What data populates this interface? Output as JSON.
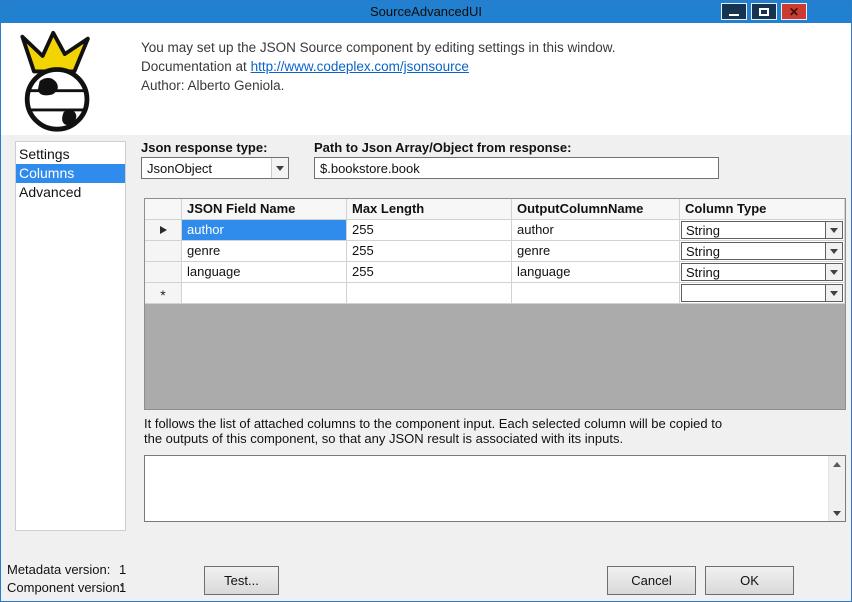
{
  "window": {
    "title": "SourceAdvancedUI"
  },
  "header": {
    "intro": "You may set up the JSON Source component by editing settings in this window.",
    "doc_prefix": "Documentation at",
    "doc_link": "http://www.codeplex.com/jsonsource",
    "author": "Author: Alberto Geniola."
  },
  "sidebar": {
    "items": [
      {
        "label": "Settings",
        "selected": false
      },
      {
        "label": "Columns",
        "selected": true
      },
      {
        "label": "Advanced",
        "selected": false
      }
    ]
  },
  "form": {
    "response_type_label": "Json response type:",
    "response_type_value": "JsonObject",
    "path_label": "Path to Json Array/Object from response:",
    "path_value": "$.bookstore.book"
  },
  "grid": {
    "columns": [
      "JSON Field Name",
      "Max Length",
      "OutputColumnName",
      "Column Type"
    ],
    "rows": [
      {
        "field": "author",
        "max_length": "255",
        "output": "author",
        "type": "String"
      },
      {
        "field": "genre",
        "max_length": "255",
        "output": "genre",
        "type": "String"
      },
      {
        "field": "language",
        "max_length": "255",
        "output": "language",
        "type": "String"
      }
    ],
    "new_row_marker": "*"
  },
  "description": "It follows the list of attached columns to the component input. Each selected column will be copied to the outputs of this component, so that any JSON result is associated with its inputs.",
  "footer": {
    "metadata_version_label": "Metadata version:",
    "metadata_version_value": "1",
    "component_version_label": "Component version:",
    "component_version_value": "1"
  },
  "buttons": {
    "test": "Test...",
    "cancel": "Cancel",
    "ok": "OK"
  },
  "colors": {
    "titlebar": "#2180cf",
    "highlight": "#2f8cec",
    "link": "#0a63c9",
    "close_button": "#cd3b30"
  }
}
